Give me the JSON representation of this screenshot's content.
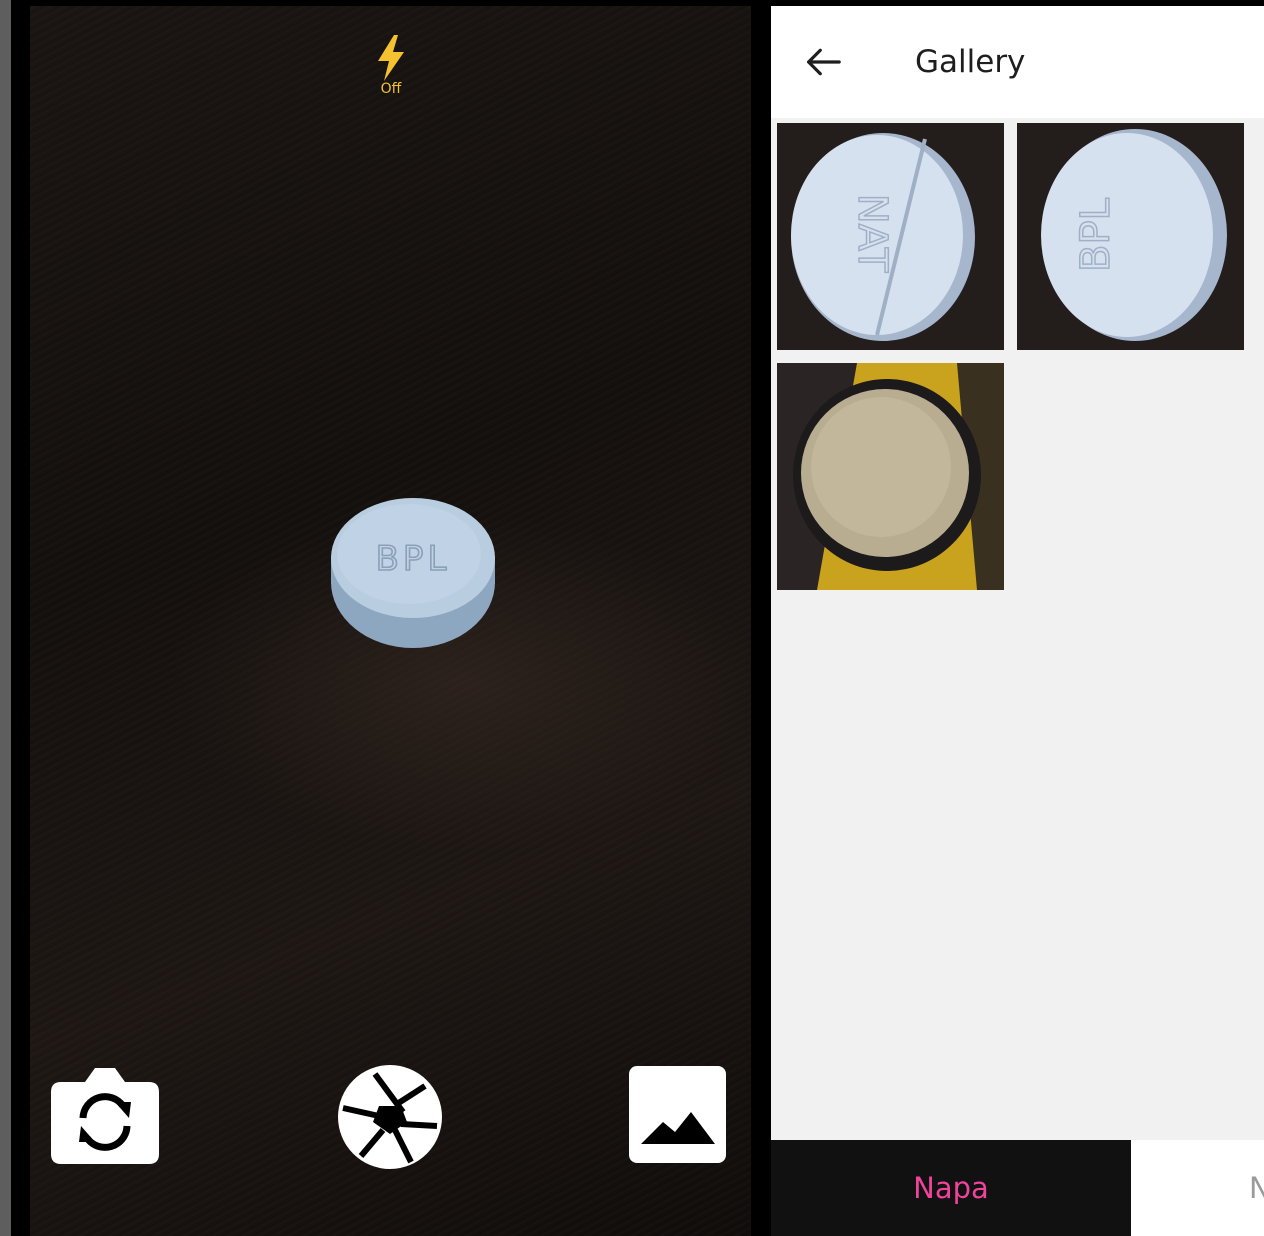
{
  "camera": {
    "flash": {
      "icon": "flash-icon",
      "label": "Off",
      "color": "#f5c12e"
    },
    "preview_pill_imprint": "BPL",
    "controls": {
      "switch_camera": {
        "icon": "switch-camera-icon"
      },
      "shutter": {
        "icon": "shutter-aperture-icon"
      },
      "gallery": {
        "icon": "image-gallery-icon"
      }
    }
  },
  "gallery": {
    "back_icon": "arrow-left-icon",
    "title": "Gallery",
    "thumbnails": [
      {
        "imprint": "NAT"
      },
      {
        "imprint": "BPL"
      },
      {
        "imprint": ""
      },
      {
        "imprint": ""
      }
    ]
  },
  "tabs": [
    {
      "label": "Napa",
      "active": true,
      "color": "#f0439b"
    },
    {
      "label": "N",
      "active": false,
      "color": "#9a9a9a"
    }
  ]
}
